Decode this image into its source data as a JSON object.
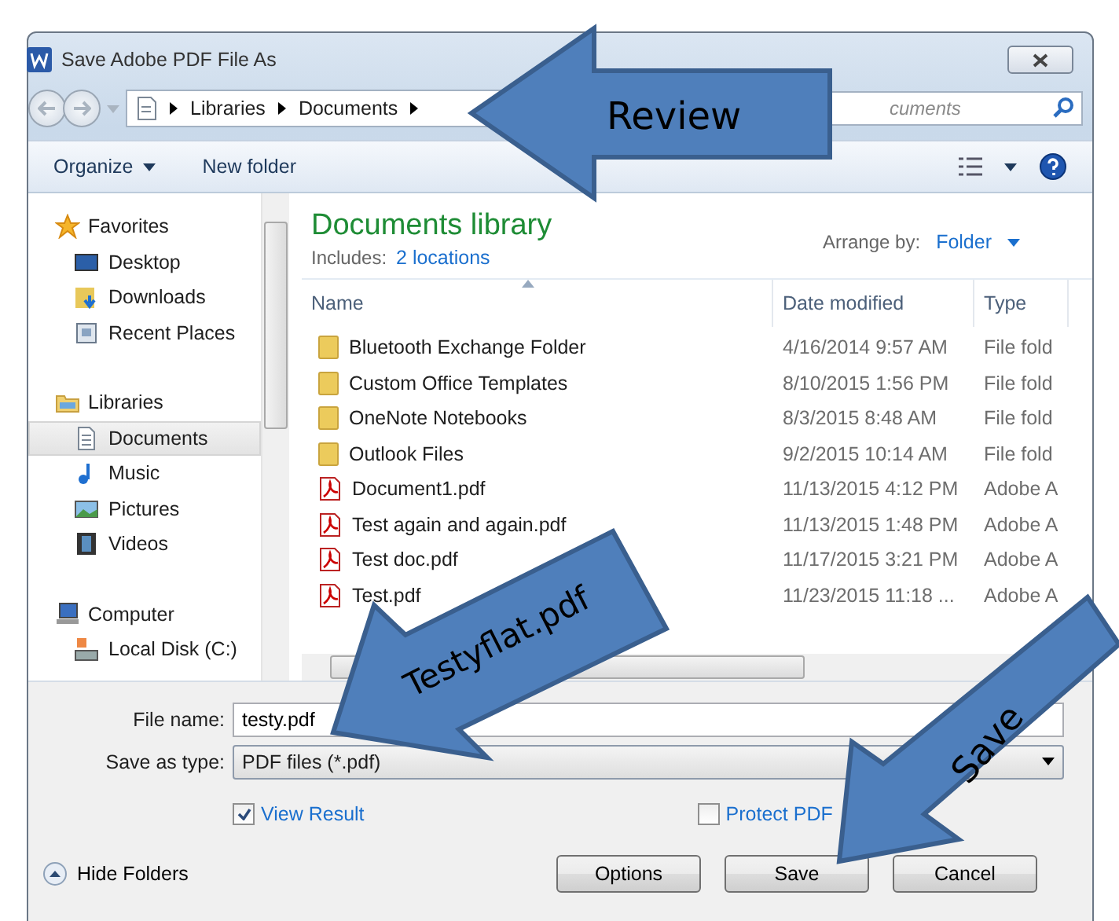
{
  "window": {
    "title": "Save Adobe PDF File As"
  },
  "address": {
    "crumbs": [
      "Libraries",
      "Documents"
    ]
  },
  "search": {
    "placeholder": "cuments"
  },
  "toolbar": {
    "buttons": [
      {
        "label": "Organize",
        "dropdown": true
      },
      {
        "label": "New folder",
        "dropdown": false
      }
    ]
  },
  "sidebar": {
    "groups": [
      {
        "label": "Favorites",
        "kind": "favorites",
        "children": [
          {
            "label": "Desktop",
            "kind": "desktop",
            "selected": false
          },
          {
            "label": "Downloads",
            "kind": "downloads",
            "selected": false
          },
          {
            "label": "Recent Places",
            "kind": "recent",
            "selected": false
          }
        ]
      },
      {
        "label": "Libraries",
        "kind": "libraries",
        "children": [
          {
            "label": "Documents",
            "kind": "documents",
            "selected": true
          },
          {
            "label": "Music",
            "kind": "music",
            "selected": false
          },
          {
            "label": "Pictures",
            "kind": "pictures",
            "selected": false
          },
          {
            "label": "Videos",
            "kind": "videos",
            "selected": false
          }
        ]
      },
      {
        "label": "Computer",
        "kind": "computer",
        "children": [
          {
            "label": "Local Disk (C:)",
            "kind": "disk",
            "selected": false
          }
        ]
      }
    ]
  },
  "library": {
    "title": "Documents library",
    "includes_label": "Includes:",
    "includes_link": "2 locations",
    "arrange_label": "Arrange by:",
    "arrange_value": "Folder"
  },
  "table": {
    "columns": [
      {
        "label": "Name",
        "sorted": true
      },
      {
        "label": "Date modified",
        "sorted": false
      },
      {
        "label": "Type",
        "sorted": false
      }
    ],
    "rows": [
      {
        "kind": "folder",
        "name": "Bluetooth Exchange Folder",
        "date": "4/16/2014 9:57 AM",
        "type": "File fold"
      },
      {
        "kind": "folder",
        "name": "Custom Office Templates",
        "date": "8/10/2015 1:56 PM",
        "type": "File fold"
      },
      {
        "kind": "folder",
        "name": "OneNote Notebooks",
        "date": "8/3/2015 8:48 AM",
        "type": "File fold"
      },
      {
        "kind": "folder",
        "name": "Outlook Files",
        "date": "9/2/2015 10:14 AM",
        "type": "File fold"
      },
      {
        "kind": "pdf",
        "name": "Document1.pdf",
        "date": "11/13/2015 4:12 PM",
        "type": "Adobe A"
      },
      {
        "kind": "pdf",
        "name": "Test again and again.pdf",
        "date": "11/13/2015 1:48 PM",
        "type": "Adobe A"
      },
      {
        "kind": "pdf",
        "name": "Test doc.pdf",
        "date": "11/17/2015 3:21 PM",
        "type": "Adobe A"
      },
      {
        "kind": "pdf",
        "name": "Test.pdf",
        "date": "11/23/2015 11:18 ...",
        "type": "Adobe A"
      }
    ]
  },
  "form": {
    "file_name": {
      "label": "File name:",
      "value": "testy.pdf"
    },
    "save_type": {
      "label": "Save as type:",
      "value": "PDF files (*.pdf)"
    },
    "options": [
      {
        "label": "View Result",
        "checked": true
      },
      {
        "label": "Protect PDF",
        "checked": false
      }
    ],
    "hide_folders": "Hide Folders",
    "buttons": [
      "Options",
      "Save",
      "Cancel"
    ]
  },
  "annotations": [
    {
      "label": "Review"
    },
    {
      "label": "Testyflat.pdf"
    },
    {
      "label": "Save"
    }
  ]
}
